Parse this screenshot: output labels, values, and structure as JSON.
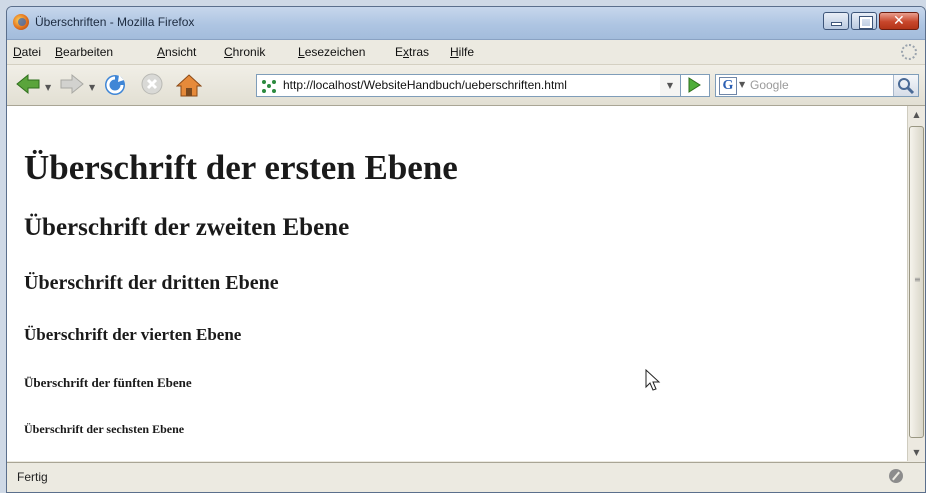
{
  "window": {
    "title": "Überschriften - Mozilla Firefox",
    "close_glyph": "✕"
  },
  "menu": {
    "items": [
      {
        "first": "D",
        "rest": "atei"
      },
      {
        "first": "B",
        "rest": "earbeiten"
      },
      {
        "first": "A",
        "rest": "nsicht"
      },
      {
        "first": "C",
        "rest": "hronik"
      },
      {
        "first": "L",
        "rest": "esezeichen"
      },
      {
        "pre": "E",
        "first": "x",
        "rest": "tras"
      },
      {
        "first": "H",
        "rest": "ilfe"
      }
    ]
  },
  "navigation": {
    "url": "http://localhost/WebsiteHandbuch/ueberschriften.html",
    "search_placeholder": "Google",
    "search_engine_letter": "G"
  },
  "content": {
    "h1": "Überschrift der ersten Ebene",
    "h2": "Überschrift der zweiten Ebene",
    "h3": "Überschrift der dritten Ebene",
    "h4": "Überschrift der vierten Ebene",
    "h5": "Überschrift der fünften Ebene",
    "h6": "Überschrift der sechsten Ebene"
  },
  "status": {
    "text": "Fertig"
  },
  "icons": {
    "back": "back-arrow-icon",
    "forward": "forward-arrow-icon",
    "reload": "reload-icon",
    "stop": "stop-icon",
    "home": "home-icon",
    "go": "go-icon",
    "search": "magnifier-icon"
  }
}
